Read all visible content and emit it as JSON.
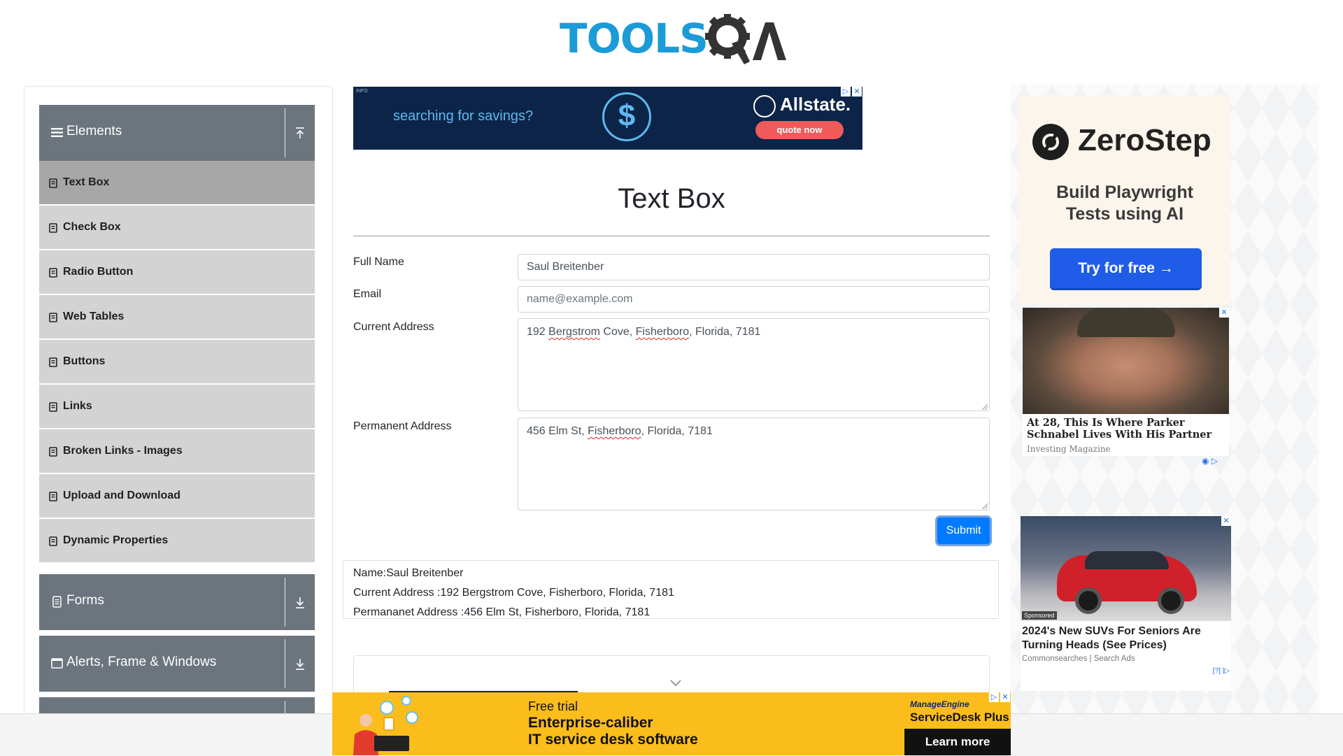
{
  "logo": {
    "text": "TOOLS",
    "accent_text": "QA",
    "brand_color": "#1b9bd7"
  },
  "sidebar": {
    "groups": [
      {
        "title": "Elements",
        "icon": "hamburger-icon",
        "state": "expanded"
      },
      {
        "title": "Forms",
        "icon": "document-icon",
        "state": "collapsed"
      },
      {
        "title": "Alerts, Frame & Windows",
        "icon": "window-icon",
        "state": "collapsed"
      }
    ],
    "items": [
      {
        "label": "Text Box",
        "active": true
      },
      {
        "label": "Check Box"
      },
      {
        "label": "Radio Button"
      },
      {
        "label": "Web Tables"
      },
      {
        "label": "Buttons"
      },
      {
        "label": "Links"
      },
      {
        "label": "Broken Links - Images"
      },
      {
        "label": "Upload and Download"
      },
      {
        "label": "Dynamic Properties"
      }
    ]
  },
  "top_ad": {
    "info": "INFO",
    "tagline": "searching for savings?",
    "brand": "Allstate.",
    "cta": "quote now"
  },
  "form": {
    "title": "Text Box",
    "full_name": {
      "label": "Full Name",
      "value": "Saul Breitenber"
    },
    "email": {
      "label": "Email",
      "value": "",
      "placeholder": "name@example.com"
    },
    "current_address": {
      "label": "Current Address",
      "parts": [
        "192 ",
        "Bergstrom",
        " Cove, ",
        "Fisherboro",
        ", Florida, 7181"
      ]
    },
    "permanent_address": {
      "label": "Permanent Address",
      "parts": [
        "456 Elm St, ",
        "Fisherboro",
        ", Florida, 7181"
      ]
    },
    "submit_label": "Submit",
    "accent_color": "#007bff"
  },
  "output": {
    "name": "Name:Saul Breitenber",
    "current_address": "Current Address :192 Bergstrom Cove, Fisherboro, Florida, 7181",
    "permanent_address": "Permananet Address :456 Elm St, Fisherboro, Florida, 7181"
  },
  "right_ads": {
    "zerostep": {
      "name": "ZeroStep",
      "subtitle_line1": "Build Playwright",
      "subtitle_line2": "Tests using AI",
      "cta": "Try for free →"
    },
    "news": {
      "headline": "At 28, This Is Where Parker Schnabel Lives With His Partner",
      "source": "Investing Magazine"
    },
    "suv": {
      "sponsored": "Sponsored",
      "headline": "2024's New SUVs For Seniors Are Turning Heads (See Prices)",
      "source": "Commonsearches | Search Ads",
      "adchoice": "[?]"
    }
  },
  "bottom_ad": {
    "free": "Free trial",
    "line1": "Enterprise-caliber",
    "line2": "IT service desk software",
    "brand1": "ManageEngine",
    "brand2": "ServiceDesk Plus",
    "cta": "Learn more"
  }
}
